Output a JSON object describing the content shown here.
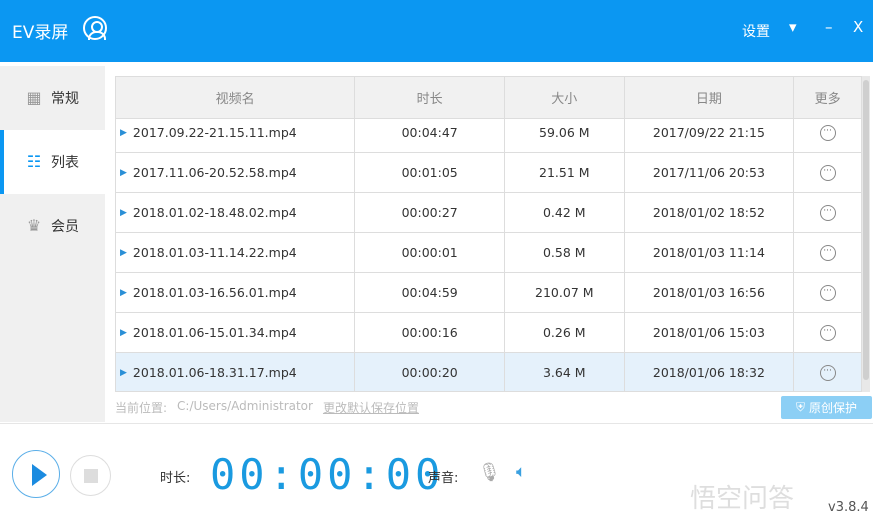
{
  "app": {
    "title": "EV录屏",
    "settings": "设置",
    "menu_icon": "▾",
    "minimize": "–",
    "close": "X"
  },
  "sidebar": {
    "items": [
      {
        "label": "常规",
        "icon": "grid-icon"
      },
      {
        "label": "列表",
        "icon": "list-icon"
      },
      {
        "label": "会员",
        "icon": "crown-icon"
      }
    ]
  },
  "table": {
    "headers": [
      "视频名",
      "时长",
      "大小",
      "日期",
      "更多"
    ],
    "rows": [
      {
        "name": "2017.09.22-21.15.11.mp4",
        "duration": "00:04:47",
        "size": "59.06 M",
        "date": "2017/09/22 21:15"
      },
      {
        "name": "2017.11.06-20.52.58.mp4",
        "duration": "00:01:05",
        "size": "21.51 M",
        "date": "2017/11/06 20:53"
      },
      {
        "name": "2018.01.02-18.48.02.mp4",
        "duration": "00:00:27",
        "size": "0.42 M",
        "date": "2018/01/02 18:52"
      },
      {
        "name": "2018.01.03-11.14.22.mp4",
        "duration": "00:00:01",
        "size": "0.58 M",
        "date": "2018/01/03 11:14"
      },
      {
        "name": "2018.01.03-16.56.01.mp4",
        "duration": "00:04:59",
        "size": "210.07 M",
        "date": "2018/01/03 16:56"
      },
      {
        "name": "2018.01.06-15.01.34.mp4",
        "duration": "00:00:16",
        "size": "0.26 M",
        "date": "2018/01/06 15:03"
      },
      {
        "name": "2018.01.06-18.31.17.mp4",
        "duration": "00:00:20",
        "size": "3.64 M",
        "date": "2018/01/06 18:32"
      }
    ]
  },
  "footer": {
    "location_label": "当前位置:",
    "path": "C:/Users/Administrator",
    "change_link": "更改默认保存位置",
    "protect_button": "原创保护"
  },
  "controls": {
    "duration_label": "时长:",
    "timer": "00:00:00",
    "sound_label": "声音:"
  },
  "watermark": "悟空问答",
  "version": "v3.8.4"
}
